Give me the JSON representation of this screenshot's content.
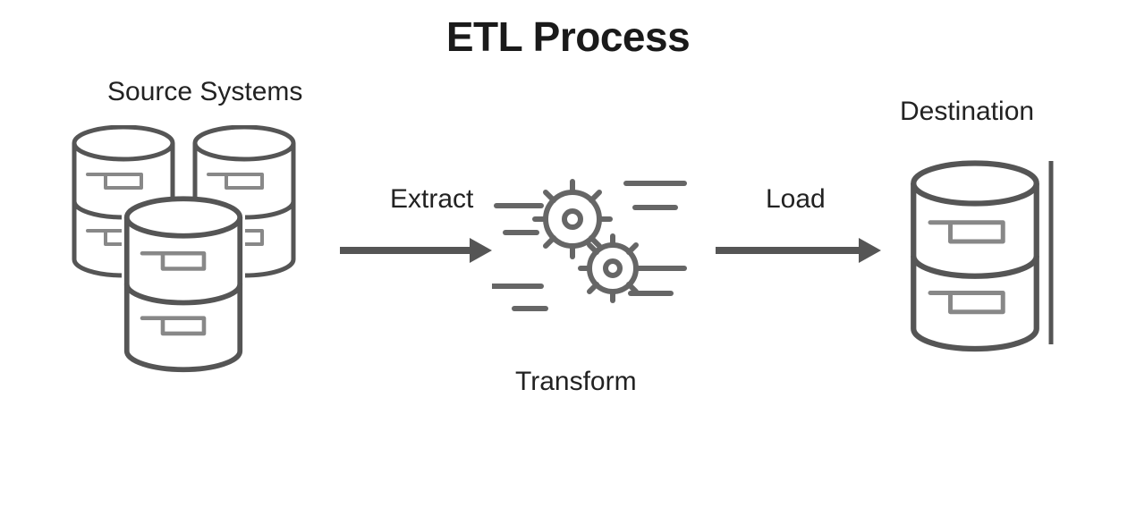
{
  "title": "ETL Process",
  "source": {
    "label": "Source Systems"
  },
  "destination": {
    "label": "Destination"
  },
  "steps": {
    "extract": "Extract",
    "transform": "Transform",
    "load": "Load"
  }
}
